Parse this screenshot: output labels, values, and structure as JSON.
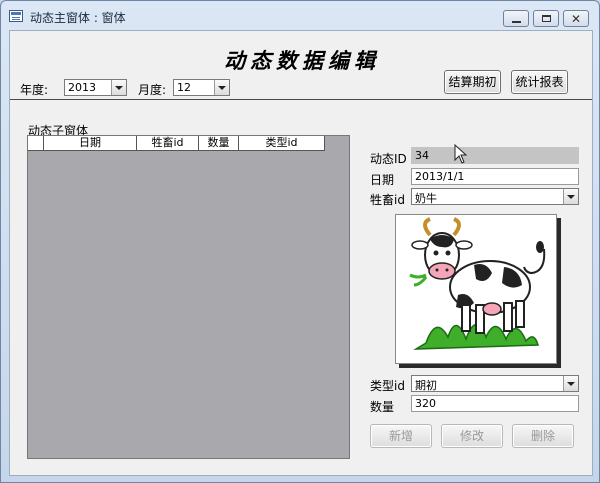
{
  "window": {
    "title": "动态主窗体 : 窗体"
  },
  "form": {
    "title": "动态数据编辑",
    "year_label": "年度:",
    "year_value": "2013",
    "month_label": "月度:",
    "month_value": "12",
    "settle_button": "结算期初",
    "report_button": "统计报表"
  },
  "subform": {
    "label": "动态子窗体",
    "columns": [
      "日期",
      "牲畜id",
      "数量",
      "类型id"
    ]
  },
  "fields": {
    "id_label": "动态ID",
    "id_value": "34",
    "date_label": "日期",
    "date_value": "2013/1/1",
    "livestock_label": "牲畜id",
    "livestock_value": "奶牛",
    "type_label": "类型id",
    "type_value": "期初",
    "qty_label": "数量",
    "qty_value": "320"
  },
  "actions": {
    "new_label": "新增",
    "edit_label": "修改",
    "delete_label": "删除"
  },
  "icons": {
    "app": "form-icon",
    "picture": "dairy-cow-icon",
    "pointer": "mouse-cursor-icon"
  }
}
